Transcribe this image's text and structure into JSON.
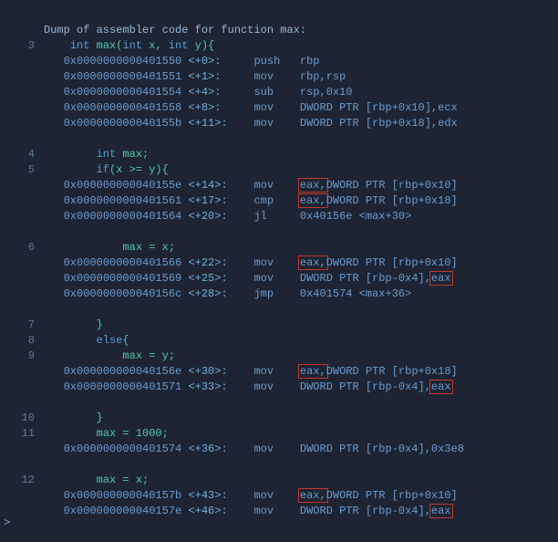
{
  "title": "Dump of assembler code for function max:",
  "src": {
    "l3": "int max(int x, int y){",
    "l4": "int max;",
    "l5": "if(x >= y){",
    "l6": "    max = x;",
    "l7": "}",
    "l8": "else{",
    "l9": "    max = y;",
    "l10": "}",
    "l11": "max = 1000;",
    "l12": "max = x;"
  },
  "kw": {
    "int": "int",
    "if": "if",
    "else": "else"
  },
  "ln": {
    "n3": "3",
    "n4": "4",
    "n5": "5",
    "n6": "6",
    "n7": "7",
    "n8": "8",
    "n9": "9",
    "n10": "10",
    "n11": "11",
    "n12": "12"
  },
  "asm": {
    "a0": {
      "addr": "0x0000000000401550",
      "off": "<+0>:",
      "mn": "push",
      "op": "rbp"
    },
    "a1": {
      "addr": "0x0000000000401551",
      "off": "<+1>:",
      "mn": "mov",
      "op": "rbp,rsp"
    },
    "a2": {
      "addr": "0x0000000000401554",
      "off": "<+4>:",
      "mn": "sub",
      "op": "rsp,0x10"
    },
    "a3": {
      "addr": "0x0000000000401558",
      "off": "<+8>:",
      "mn": "mov",
      "op": "DWORD PTR [rbp+0x10],ecx"
    },
    "a4": {
      "addr": "0x000000000040155b",
      "off": "<+11>:",
      "mn": "mov",
      "op": "DWORD PTR [rbp+0x18],edx"
    },
    "a5": {
      "addr": "0x000000000040155e",
      "off": "<+14>:",
      "mn": "mov",
      "op1": "eax,",
      "op2": "DWORD PTR [rbp+0x10]"
    },
    "a6": {
      "addr": "0x0000000000401561",
      "off": "<+17>:",
      "mn": "cmp",
      "op1": "eax,",
      "op2": "DWORD PTR [rbp+0x18]"
    },
    "a7": {
      "addr": "0x0000000000401564",
      "off": "<+20>:",
      "mn": "jl",
      "op": "0x40156e <max+30>"
    },
    "a8": {
      "addr": "0x0000000000401566",
      "off": "<+22>:",
      "mn": "mov",
      "op1": "eax,",
      "op2": "DWORD PTR [rbp+0x10]"
    },
    "a9": {
      "addr": "0x0000000000401569",
      "off": "<+25>:",
      "mn": "mov",
      "op1": "DWORD PTR [rbp-0x4],",
      "op2": "eax"
    },
    "a10": {
      "addr": "0x000000000040156c",
      "off": "<+28>:",
      "mn": "jmp",
      "op": "0x401574 <max+36>"
    },
    "a11": {
      "addr": "0x000000000040156e",
      "off": "<+30>:",
      "mn": "mov",
      "op1": "eax,",
      "op2": "DWORD PTR [rbp+0x18]"
    },
    "a12": {
      "addr": "0x0000000000401571",
      "off": "<+33>:",
      "mn": "mov",
      "op1": "DWORD PTR [rbp-0x4],",
      "op2": "eax"
    },
    "a13": {
      "addr": "0x0000000000401574",
      "off": "<+36>:",
      "mn": "mov",
      "op": "DWORD PTR [rbp-0x4],0x3e8"
    },
    "a14": {
      "addr": "0x000000000040157b",
      "off": "<+43>:",
      "mn": "mov",
      "op1": "eax,",
      "op2": "DWORD PTR [rbp+0x10]"
    },
    "a15": {
      "addr": "0x000000000040157e",
      "off": "<+46>:",
      "mn": "mov",
      "op1": "DWORD PTR [rbp-0x4],",
      "op2": "eax"
    }
  },
  "prompt": ">"
}
